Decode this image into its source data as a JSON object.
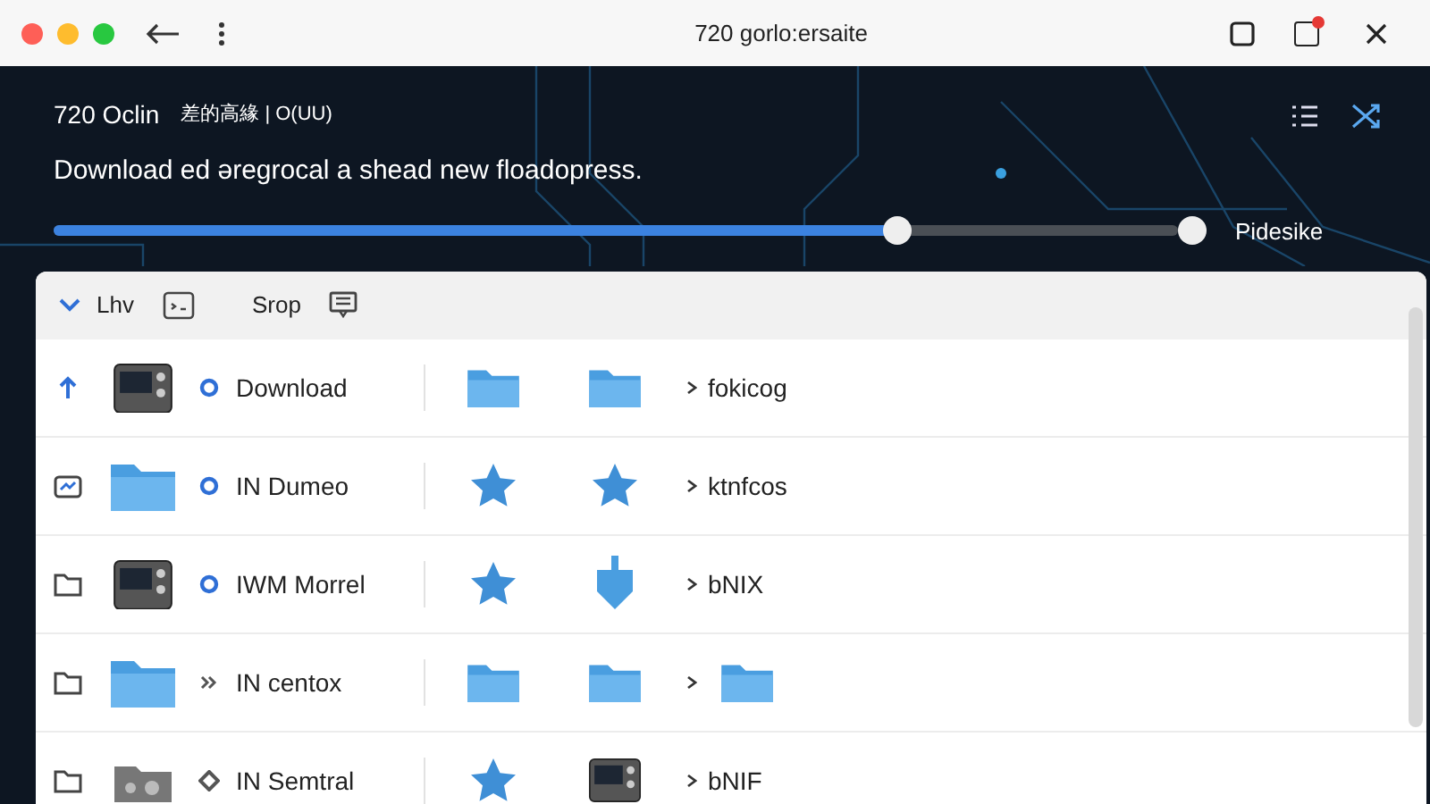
{
  "window": {
    "title": "720 gorlo:ersaite",
    "notification": true
  },
  "header": {
    "title": "720 Oclin",
    "subtitle": "差的高緣 | O(UU)",
    "message": "Download ed  əregrocal a shead  new floadopress."
  },
  "progress": {
    "level": 0.75,
    "end_label": "Pidesike"
  },
  "toolbar": [
    {
      "kind": "chevron",
      "label": "Lhv"
    },
    {
      "kind": "box"
    },
    {
      "kind": "text",
      "label": "Srop"
    },
    {
      "kind": "note"
    }
  ],
  "rows": [
    {
      "lead": {
        "kind": "arrow"
      },
      "thumb": {
        "kind": "device"
      },
      "status": {
        "kind": "ring"
      },
      "name": "Download",
      "cells": [
        {
          "kind": "folder"
        },
        {
          "kind": "folder"
        }
      ],
      "tail": "fokicog"
    },
    {
      "lead": {
        "kind": "chart"
      },
      "thumb": {
        "kind": "folder"
      },
      "status": {
        "kind": "ring"
      },
      "name": "IN Dumeo",
      "cells": [
        {
          "kind": "star"
        },
        {
          "kind": "star"
        }
      ],
      "tail": "ktnfcos"
    },
    {
      "lead": {
        "kind": "outline"
      },
      "thumb": {
        "kind": "device"
      },
      "status": {
        "kind": "ring"
      },
      "name": "IWM Morrel",
      "cells": [
        {
          "kind": "star"
        },
        {
          "kind": "shield"
        }
      ],
      "tail": "bNIX"
    },
    {
      "lead": {
        "kind": "outline"
      },
      "thumb": {
        "kind": "folder"
      },
      "status": {
        "kind": "chevrons"
      },
      "name": "IN centox",
      "cells": [
        {
          "kind": "folder"
        },
        {
          "kind": "folder"
        }
      ],
      "tail_icon": {
        "kind": "folder"
      }
    },
    {
      "lead": {
        "kind": "outline"
      },
      "thumb": {
        "kind": "drive"
      },
      "status": {
        "kind": "diamond"
      },
      "name": "IN Semtral",
      "cells": [
        {
          "kind": "star"
        },
        {
          "kind": "device"
        }
      ],
      "tail": "bNIF"
    }
  ]
}
